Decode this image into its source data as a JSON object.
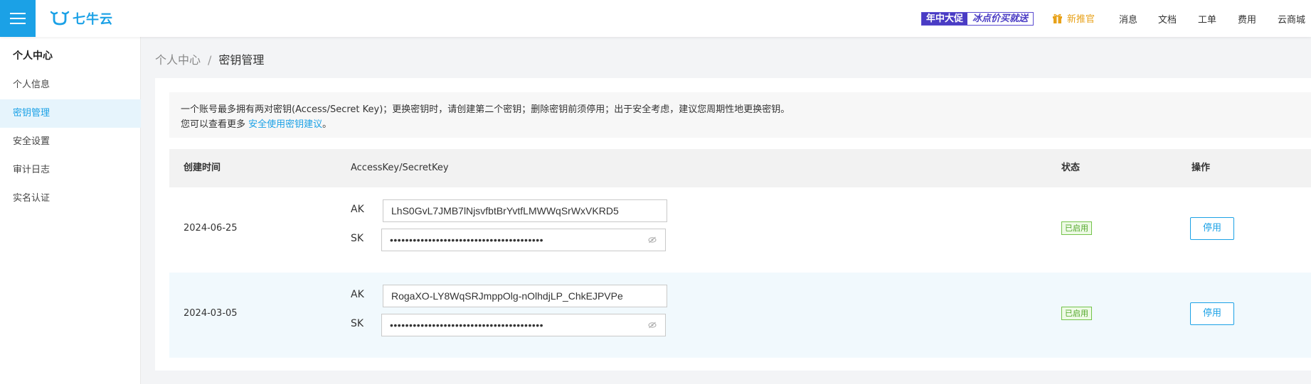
{
  "header": {
    "logo_text": "七牛云",
    "promo": {
      "part1": "年中大促",
      "part2": "冰点价买就送"
    },
    "newbie_label": "新推官",
    "nav": [
      "消息",
      "文档",
      "工单",
      "费用",
      "云商城"
    ],
    "accent_color": "#1ba1e6"
  },
  "sidebar": {
    "title": "个人中心",
    "items": [
      {
        "label": "个人信息",
        "active": false
      },
      {
        "label": "密钥管理",
        "active": true
      },
      {
        "label": "安全设置",
        "active": false
      },
      {
        "label": "审计日志",
        "active": false
      },
      {
        "label": "实名认证",
        "active": false
      }
    ]
  },
  "breadcrumb": {
    "parent": "个人中心",
    "separator": "/",
    "current": "密钥管理"
  },
  "notice": {
    "line1": "一个账号最多拥有两对密钥(Access/Secret Key)；更换密钥时，请创建第二个密钥；删除密钥前须停用；出于安全考虑，建议您周期性地更换密钥。",
    "line2_prefix": "您可以查看更多 ",
    "line2_link": "安全使用密钥建议",
    "line2_suffix": "。"
  },
  "table": {
    "columns": {
      "created": "创建时间",
      "keys": "AccessKey/SecretKey",
      "status": "状态",
      "action": "操作"
    },
    "ak_label": "AK",
    "sk_label": "SK",
    "rows": [
      {
        "date": "2024-06-25",
        "ak": "LhS0GvL7JMB7lNjsvfbtBrYvtfLMWWqSrWxVKRD5",
        "sk": "••••••••••••••••••••••••••••••••••••••••",
        "status": "已启用",
        "action": "停用"
      },
      {
        "date": "2024-03-05",
        "ak": "RogaXO-LY8WqSRJmppOlg-nOlhdjLP_ChkEJPVPe",
        "sk": "••••••••••••••••••••••••••••••••••••••••",
        "status": "已启用",
        "action": "停用"
      }
    ]
  }
}
